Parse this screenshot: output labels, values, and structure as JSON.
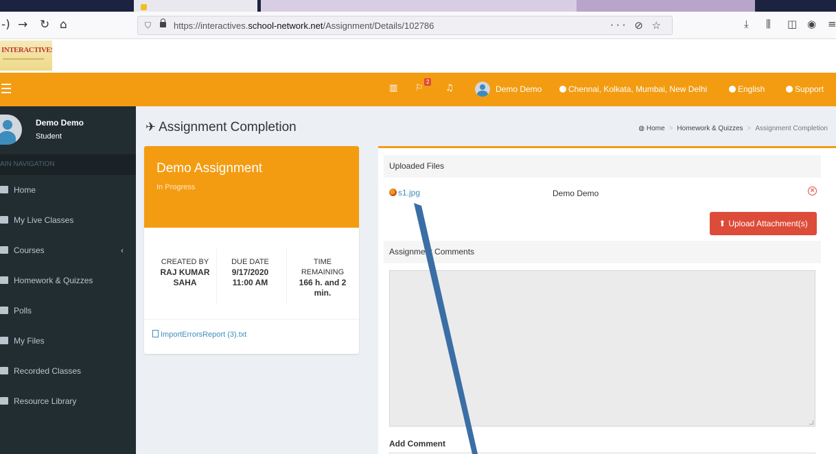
{
  "browser": {
    "url_prefix": "https://interactives.",
    "url_domain": "school-network.net",
    "url_path": "/Assignment/Details/102786",
    "url_actions": "··· ⊘ ☆"
  },
  "logo": {
    "text": "INTERACTIVES"
  },
  "header": {
    "notification_count": "2",
    "user_name": "Demo Demo",
    "timezone": "Chennai, Kolkata, Mumbai, New Delhi",
    "language": "English",
    "support": "Support"
  },
  "sidebar": {
    "user_name": "Demo Demo",
    "user_role": "Student",
    "nav_header": "AIN NAVIGATION",
    "items": [
      {
        "label": "Home"
      },
      {
        "label": "My Live Classes"
      },
      {
        "label": "Courses"
      },
      {
        "label": "Homework & Quizzes"
      },
      {
        "label": "Polls"
      },
      {
        "label": "My Files"
      },
      {
        "label": "Recorded Classes"
      },
      {
        "label": "Resource Library"
      }
    ]
  },
  "page": {
    "title": "Assignment Completion",
    "breadcrumb": [
      "Home",
      "Homework & Quizzes",
      "Assignment Completion"
    ]
  },
  "assignment": {
    "title": "Demo Assignment",
    "status": "In Progress",
    "created_by_label": "CREATED BY",
    "created_by_value_1": "RAJ KUMAR",
    "created_by_value_2": "SAHA",
    "due_date_label": "DUE DATE",
    "due_date_value_1": "9/17/2020",
    "due_date_value_2": "11:00 AM",
    "time_label_1": "TIME",
    "time_label_2": "REMAINING",
    "time_value_1": "166 h. and 2",
    "time_value_2": "min.",
    "attachment": "ImportErrorsReport (3).txt"
  },
  "uploads": {
    "section_label": "Uploaded Files",
    "files": [
      {
        "name": "s1.jpg",
        "owner": "Demo Demo"
      }
    ],
    "upload_button": "Upload Attachment(s)",
    "comments_label": "Assignment Comments",
    "add_comment_label": "Add Comment"
  },
  "colors": {
    "accent": "#f39c12",
    "sidebar": "#222d32",
    "danger": "#dd4b39",
    "link": "#3c8dbc",
    "annotation_arrow": "#3a6ea5"
  }
}
